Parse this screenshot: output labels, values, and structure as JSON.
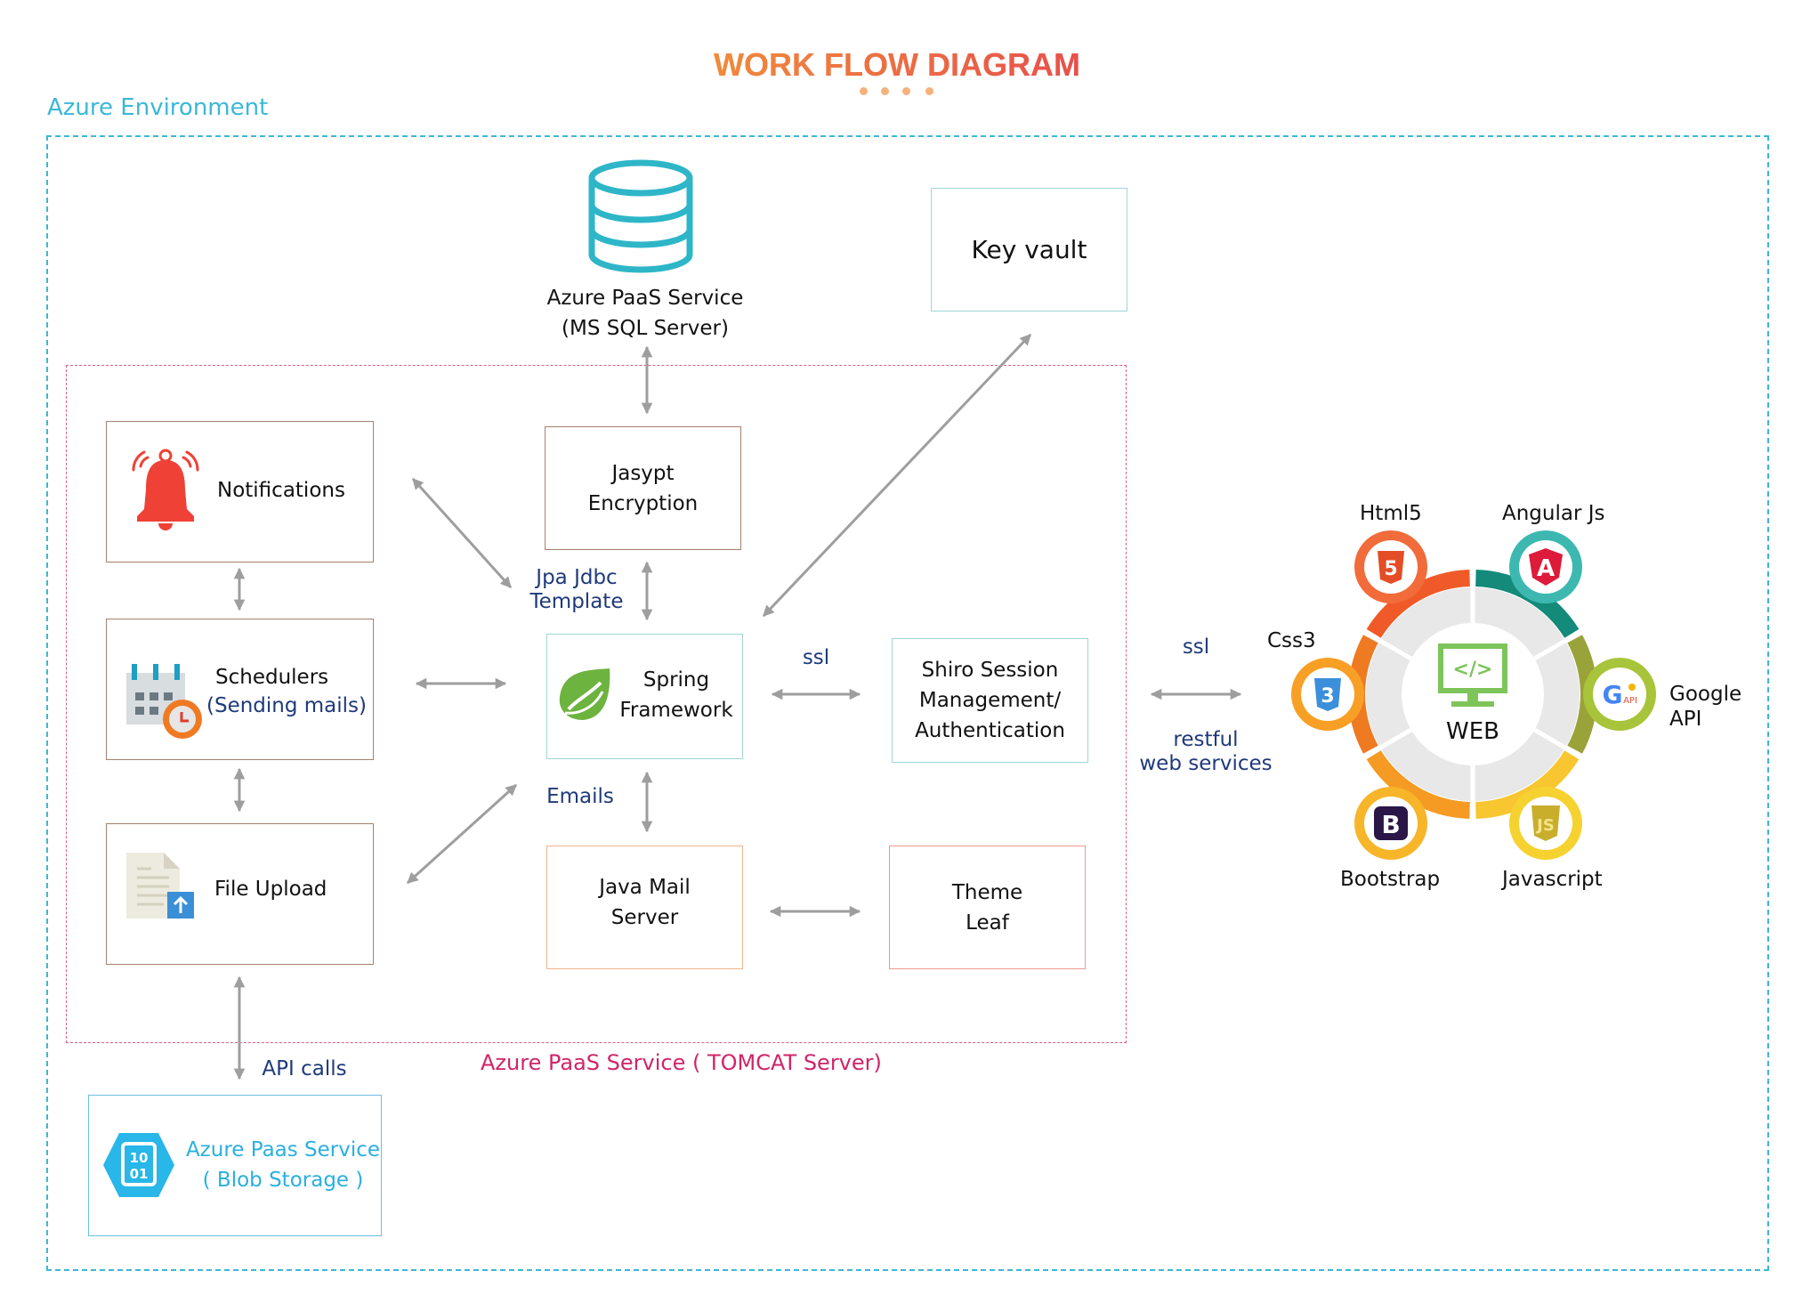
{
  "title": "WORK FLOW DIAGRAM",
  "environment_label": "Azure Environment",
  "tomcat_label": "Azure PaaS Service ( TOMCAT Server)",
  "database": {
    "line1": "Azure PaaS Service",
    "line2": "(MS SQL Server)",
    "icon": "database-icon"
  },
  "key_vault": {
    "label": "Key vault"
  },
  "left_column": {
    "notifications": {
      "label": "Notifications",
      "icon": "bell-icon"
    },
    "schedulers": {
      "label": "Schedulers",
      "sublabel": "(Sending mails)",
      "icon": "calendar-clock-icon"
    },
    "file_upload": {
      "label": "File Upload",
      "icon": "file-upload-icon"
    }
  },
  "blob_storage": {
    "line1": "Azure Paas Service",
    "line2": "( Blob Storage )",
    "icon": "blob-storage-icon",
    "icon_text_top": "10",
    "icon_text_bottom": "01"
  },
  "center_column": {
    "jasypt": {
      "line1": "Jasypt",
      "line2": "Encryption"
    },
    "spring": {
      "line1": "Spring",
      "line2": "Framework",
      "icon": "spring-leaf-icon"
    },
    "java_mail": {
      "line1": "Java Mail",
      "line2": "Server"
    }
  },
  "right_column": {
    "shiro": {
      "line1": "Shiro Session",
      "line2": "Management/",
      "line3": "Authentication"
    },
    "theme_leaf": {
      "line1": "Theme",
      "line2": "Leaf"
    }
  },
  "connector_labels": {
    "jpa_line1": "Jpa Jdbc",
    "jpa_line2": "Template",
    "ssl_inner": "ssl",
    "emails": "Emails",
    "api_calls": "API calls",
    "ssl_outer": "ssl",
    "restful_line1": "restful",
    "restful_line2": "web services"
  },
  "web_hub": {
    "center_label": "WEB",
    "center_icon": "code-monitor-icon",
    "technologies": [
      {
        "name": "Html5",
        "icon": "html5-icon",
        "glyph": "5",
        "ring_color": "#F05A28",
        "badge_color": "#F26B3A"
      },
      {
        "name": "Angular Js",
        "icon": "angular-icon",
        "glyph": "A",
        "ring_color": "#138A7A",
        "badge_color": "#3DB8B0"
      },
      {
        "name": "Css3",
        "icon": "css3-icon",
        "glyph": "3",
        "ring_color": "#EE7A22",
        "badge_color": "#F7A025"
      },
      {
        "name": "Google API",
        "icon": "google-api-icon",
        "glyph": "G",
        "ring_color": "#9AA23A",
        "badge_color": "#A8C43A"
      },
      {
        "name": "Bootstrap",
        "icon": "bootstrap-icon",
        "glyph": "B",
        "ring_color": "#F59A22",
        "badge_color": "#F7B52A"
      },
      {
        "name": "Javascript",
        "icon": "javascript-icon",
        "glyph": "JS",
        "ring_color": "#F8C630",
        "badge_color": "#F6D230"
      }
    ],
    "google_line1": "Google",
    "google_line2": "API",
    "api_small": "API"
  },
  "colors": {
    "title_start": "#F08A3C",
    "title_end": "#E8504C",
    "azure_cyan": "#3BB8D8",
    "tomcat_pink": "#D0246A",
    "arrow_gray": "#9E9E9E",
    "label_navy": "#1F3A7A"
  }
}
